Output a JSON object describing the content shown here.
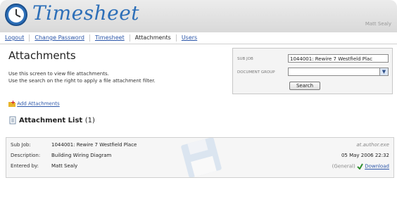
{
  "app": {
    "title": "Timesheet",
    "user": "Matt Sealy"
  },
  "nav": {
    "items": [
      {
        "label": "Logout"
      },
      {
        "label": "Change Password"
      },
      {
        "label": "Timesheet"
      },
      {
        "label": "Attachments"
      },
      {
        "label": "Users"
      }
    ],
    "active": "Attachments"
  },
  "page": {
    "title": "Attachments",
    "desc_line1": "Use this screen to view file attachments.",
    "desc_line2": "Use the search on the right to apply a file attachment filter."
  },
  "filter": {
    "subjob_label": "SUB JOB",
    "subjob_value": "1044001: Rewire 7 Westfield Plac",
    "docgroup_label": "DOCUMENT GROUP",
    "docgroup_value": "",
    "search_label": "Search"
  },
  "add_attachments": {
    "label": "Add Attachments"
  },
  "list": {
    "title": "Attachment List",
    "count": "(1)"
  },
  "record": {
    "subjob_label": "Sub Job:",
    "subjob_value": "1044001: Rewire 7 Westfield Place",
    "description_label": "Description:",
    "description_value": "Building Wiring Diagram",
    "entered_label": "Entered by:",
    "entered_value": "Matt Sealy",
    "file_name": "at.author.exe",
    "date": "05 May 2006 22:32",
    "group": "(General)",
    "download_label": "Download"
  },
  "colors": {
    "accent": "#2d6fb8",
    "link": "#2a55a8"
  }
}
